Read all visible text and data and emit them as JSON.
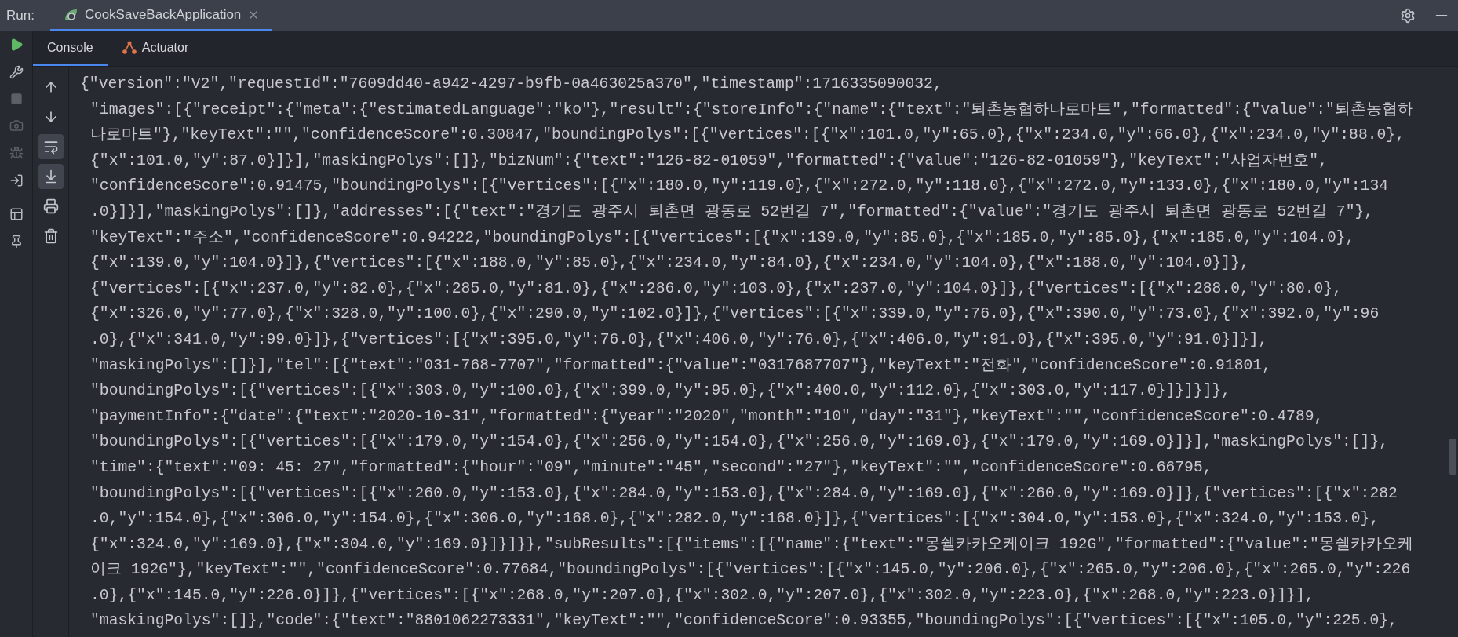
{
  "run_bar": {
    "label": "Run:",
    "tabs": [
      {
        "label": "CookSaveBackApplication",
        "selected": true
      }
    ]
  },
  "console_tabs": [
    {
      "label": "Console",
      "kind": "console",
      "selected": true
    },
    {
      "label": "Actuator",
      "kind": "actuator",
      "selected": false
    }
  ],
  "toolbar": [
    {
      "kind": "up",
      "on": false
    },
    {
      "kind": "down",
      "on": false
    },
    {
      "kind": "wrap",
      "on": true
    },
    {
      "kind": "scroll-end",
      "on": true
    },
    {
      "kind": "print",
      "on": false
    },
    {
      "kind": "clear",
      "on": false
    }
  ],
  "console": {
    "lines": [
      "{\"version\":\"V2\",\"requestId\":\"7609dd40-a942-4297-b9fb-0a463025a370\",\"timestamp\":1716335090032,",
      "\"images\":[{\"receipt\":{\"meta\":{\"estimatedLanguage\":\"ko\"},\"result\":{\"storeInfo\":{\"name\":{\"text\":\"퇴촌농협하나로마트\",\"formatted\":{\"value\":\"퇴촌농협하",
      "나로마트\"},\"keyText\":\"\",\"confidenceScore\":0.30847,\"boundingPolys\":[{\"vertices\":[{\"x\":101.0,\"y\":65.0},{\"x\":234.0,\"y\":66.0},{\"x\":234.0,\"y\":88.0},",
      "{\"x\":101.0,\"y\":87.0}]}],\"maskingPolys\":[]},\"bizNum\":{\"text\":\"126-82-01059\",\"formatted\":{\"value\":\"126-82-01059\"},\"keyText\":\"사업자번호\",",
      "\"confidenceScore\":0.91475,\"boundingPolys\":[{\"vertices\":[{\"x\":180.0,\"y\":119.0},{\"x\":272.0,\"y\":118.0},{\"x\":272.0,\"y\":133.0},{\"x\":180.0,\"y\":134",
      ".0}]}],\"maskingPolys\":[]},\"addresses\":[{\"text\":\"경기도 광주시 퇴촌면 광동로 52번길 7\",\"formatted\":{\"value\":\"경기도 광주시 퇴촌면 광동로 52번길 7\"},",
      "\"keyText\":\"주소\",\"confidenceScore\":0.94222,\"boundingPolys\":[{\"vertices\":[{\"x\":139.0,\"y\":85.0},{\"x\":185.0,\"y\":85.0},{\"x\":185.0,\"y\":104.0},",
      "{\"x\":139.0,\"y\":104.0}]},{\"vertices\":[{\"x\":188.0,\"y\":85.0},{\"x\":234.0,\"y\":84.0},{\"x\":234.0,\"y\":104.0},{\"x\":188.0,\"y\":104.0}]},",
      "{\"vertices\":[{\"x\":237.0,\"y\":82.0},{\"x\":285.0,\"y\":81.0},{\"x\":286.0,\"y\":103.0},{\"x\":237.0,\"y\":104.0}]},{\"vertices\":[{\"x\":288.0,\"y\":80.0},",
      "{\"x\":326.0,\"y\":77.0},{\"x\":328.0,\"y\":100.0},{\"x\":290.0,\"y\":102.0}]},{\"vertices\":[{\"x\":339.0,\"y\":76.0},{\"x\":390.0,\"y\":73.0},{\"x\":392.0,\"y\":96",
      ".0},{\"x\":341.0,\"y\":99.0}]},{\"vertices\":[{\"x\":395.0,\"y\":76.0},{\"x\":406.0,\"y\":76.0},{\"x\":406.0,\"y\":91.0},{\"x\":395.0,\"y\":91.0}]}],",
      "\"maskingPolys\":[]}],\"tel\":[{\"text\":\"031-768-7707\",\"formatted\":{\"value\":\"0317687707\"},\"keyText\":\"전화\",\"confidenceScore\":0.91801,",
      "\"boundingPolys\":[{\"vertices\":[{\"x\":303.0,\"y\":100.0},{\"x\":399.0,\"y\":95.0},{\"x\":400.0,\"y\":112.0},{\"x\":303.0,\"y\":117.0}]}]}]},",
      "\"paymentInfo\":{\"date\":{\"text\":\"2020-10-31\",\"formatted\":{\"year\":\"2020\",\"month\":\"10\",\"day\":\"31\"},\"keyText\":\"\",\"confidenceScore\":0.4789,",
      "\"boundingPolys\":[{\"vertices\":[{\"x\":179.0,\"y\":154.0},{\"x\":256.0,\"y\":154.0},{\"x\":256.0,\"y\":169.0},{\"x\":179.0,\"y\":169.0}]}],\"maskingPolys\":[]},",
      "\"time\":{\"text\":\"09: 45: 27\",\"formatted\":{\"hour\":\"09\",\"minute\":\"45\",\"second\":\"27\"},\"keyText\":\"\",\"confidenceScore\":0.66795,",
      "\"boundingPolys\":[{\"vertices\":[{\"x\":260.0,\"y\":153.0},{\"x\":284.0,\"y\":153.0},{\"x\":284.0,\"y\":169.0},{\"x\":260.0,\"y\":169.0}]},{\"vertices\":[{\"x\":282",
      ".0,\"y\":154.0},{\"x\":306.0,\"y\":154.0},{\"x\":306.0,\"y\":168.0},{\"x\":282.0,\"y\":168.0}]},{\"vertices\":[{\"x\":304.0,\"y\":153.0},{\"x\":324.0,\"y\":153.0},",
      "{\"x\":324.0,\"y\":169.0},{\"x\":304.0,\"y\":169.0}]}]}},\"subResults\":[{\"items\":[{\"name\":{\"text\":\"몽쉘카카오케이크 192G\",\"formatted\":{\"value\":\"몽쉘카카오케",
      "이크 192G\"},\"keyText\":\"\",\"confidenceScore\":0.77684,\"boundingPolys\":[{\"vertices\":[{\"x\":145.0,\"y\":206.0},{\"x\":265.0,\"y\":206.0},{\"x\":265.0,\"y\":226",
      ".0},{\"x\":145.0,\"y\":226.0}]},{\"vertices\":[{\"x\":268.0,\"y\":207.0},{\"x\":302.0,\"y\":207.0},{\"x\":302.0,\"y\":223.0},{\"x\":268.0,\"y\":223.0}]}],",
      "\"maskingPolys\":[]},\"code\":{\"text\":\"8801062273331\",\"keyText\":\"\",\"confidenceScore\":0.93355,\"boundingPolys\":[{\"vertices\":[{\"x\":105.0,\"y\":225.0},"
    ]
  }
}
